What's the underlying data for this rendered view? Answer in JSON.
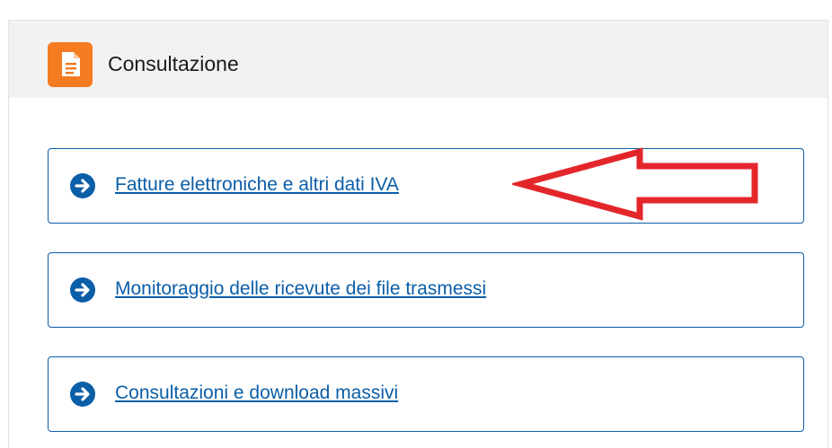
{
  "panel": {
    "title": "Consultazione",
    "title_icon": "document-icon",
    "accent_color": "#f47b20"
  },
  "links": [
    {
      "label": "Fatture elettroniche e altri dati IVA",
      "icon": "arrow-right-circle-icon"
    },
    {
      "label": "Monitoraggio delle ricevute dei file trasmessi",
      "icon": "arrow-right-circle-icon"
    },
    {
      "label": "Consultazioni e download massivi",
      "icon": "arrow-right-circle-icon"
    }
  ],
  "link_color": "#0b5ea8",
  "annotation": {
    "icon": "red-pointer-arrow-icon",
    "color": "#e3262b"
  }
}
